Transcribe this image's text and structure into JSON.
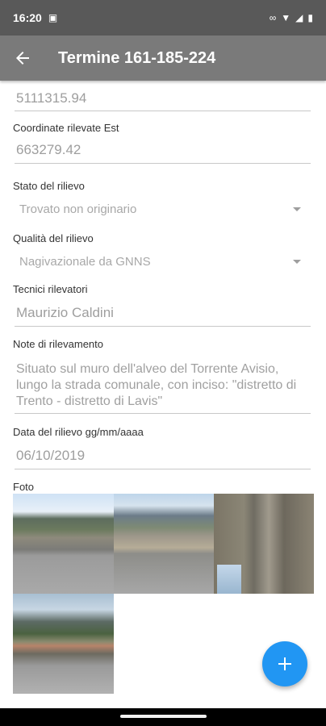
{
  "status_bar": {
    "time": "16:20"
  },
  "app_bar": {
    "title": "Termine 161-185-224"
  },
  "fields": {
    "coord_nord_value": "5111315.94",
    "coord_est_label": "Coordinate rilevate Est",
    "coord_est_value": "663279.42",
    "stato_label": "Stato del rilievo",
    "stato_value": "Trovato non originario",
    "qualita_label": "Qualità del rilievo",
    "qualita_value": "Nagivazionale da GNNS",
    "tecnici_label": "Tecnici rilevatori",
    "tecnici_value": "Maurizio Caldini",
    "note_label": "Note di rilevamento",
    "note_value": "Situato sul muro dell'alveo del Torrente Avisio, lungo la strada comunale, con inciso: \"distretto di Trento - distretto di Lavis\"",
    "data_label": "Data del rilievo gg/mm/aaaa",
    "data_value": "06/10/2019",
    "foto_label": "Foto"
  },
  "fab": {
    "icon": "plus-icon",
    "color": "#2196f3"
  },
  "colors": {
    "status_bar": "#595959",
    "app_bar": "#7a7a7a",
    "accent": "#2196f3"
  }
}
